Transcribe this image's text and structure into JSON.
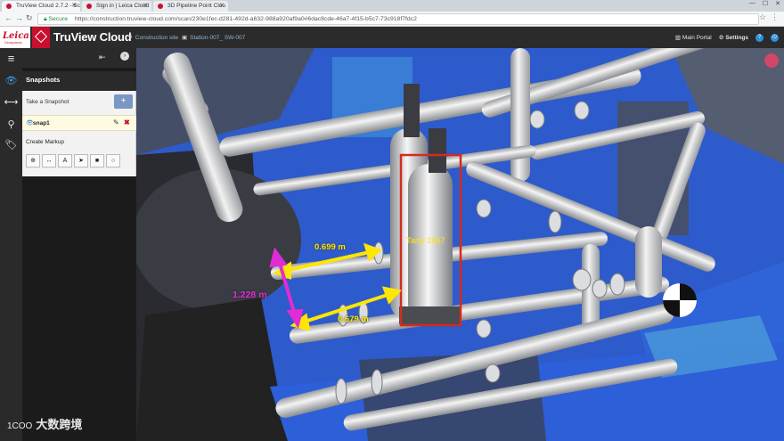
{
  "browser": {
    "tabs": [
      {
        "label": "TruView Cloud 2.7.2 - Sc"
      },
      {
        "label": "Sign in | Leica Cloud"
      },
      {
        "label": "3D Pipeline Point Clou"
      }
    ],
    "secure_label": "Secure",
    "url": "https://construction.truview-cloud.com/scan/230e1fec-d281-492d-a632-988a920af9a0#6dac8cde-46a7-4f15-b5c7-73c918f7fdc2"
  },
  "header": {
    "leica": "Leica",
    "leica_sub": "Geosystems",
    "app_name": "TruView Cloud",
    "site": "Construction site",
    "station": "Station-007_ SW-007",
    "main_portal": "Main Portal",
    "settings": "Settings"
  },
  "panel": {
    "title": "Snapshots",
    "take_snapshot": "Take a Snapshot",
    "add_symbol": "+",
    "snapshot_name": "snap1",
    "create_markup": "Create Markup",
    "tools": [
      "⊕",
      "↔",
      "A",
      "➤",
      "■",
      "○"
    ]
  },
  "viewport": {
    "measurements": {
      "top": "0.699 m",
      "bottom": "0.679 m",
      "vertical": "1.228 m"
    },
    "tank_label": "Tank 1567"
  },
  "watermark": {
    "logo": "1COO",
    "text": "大数跨境"
  },
  "colors": {
    "leica_red": "#c8102e",
    "measure_yellow": "#ffe600",
    "measure_magenta": "#e02cd4",
    "highlight_red": "#d42b1e"
  }
}
